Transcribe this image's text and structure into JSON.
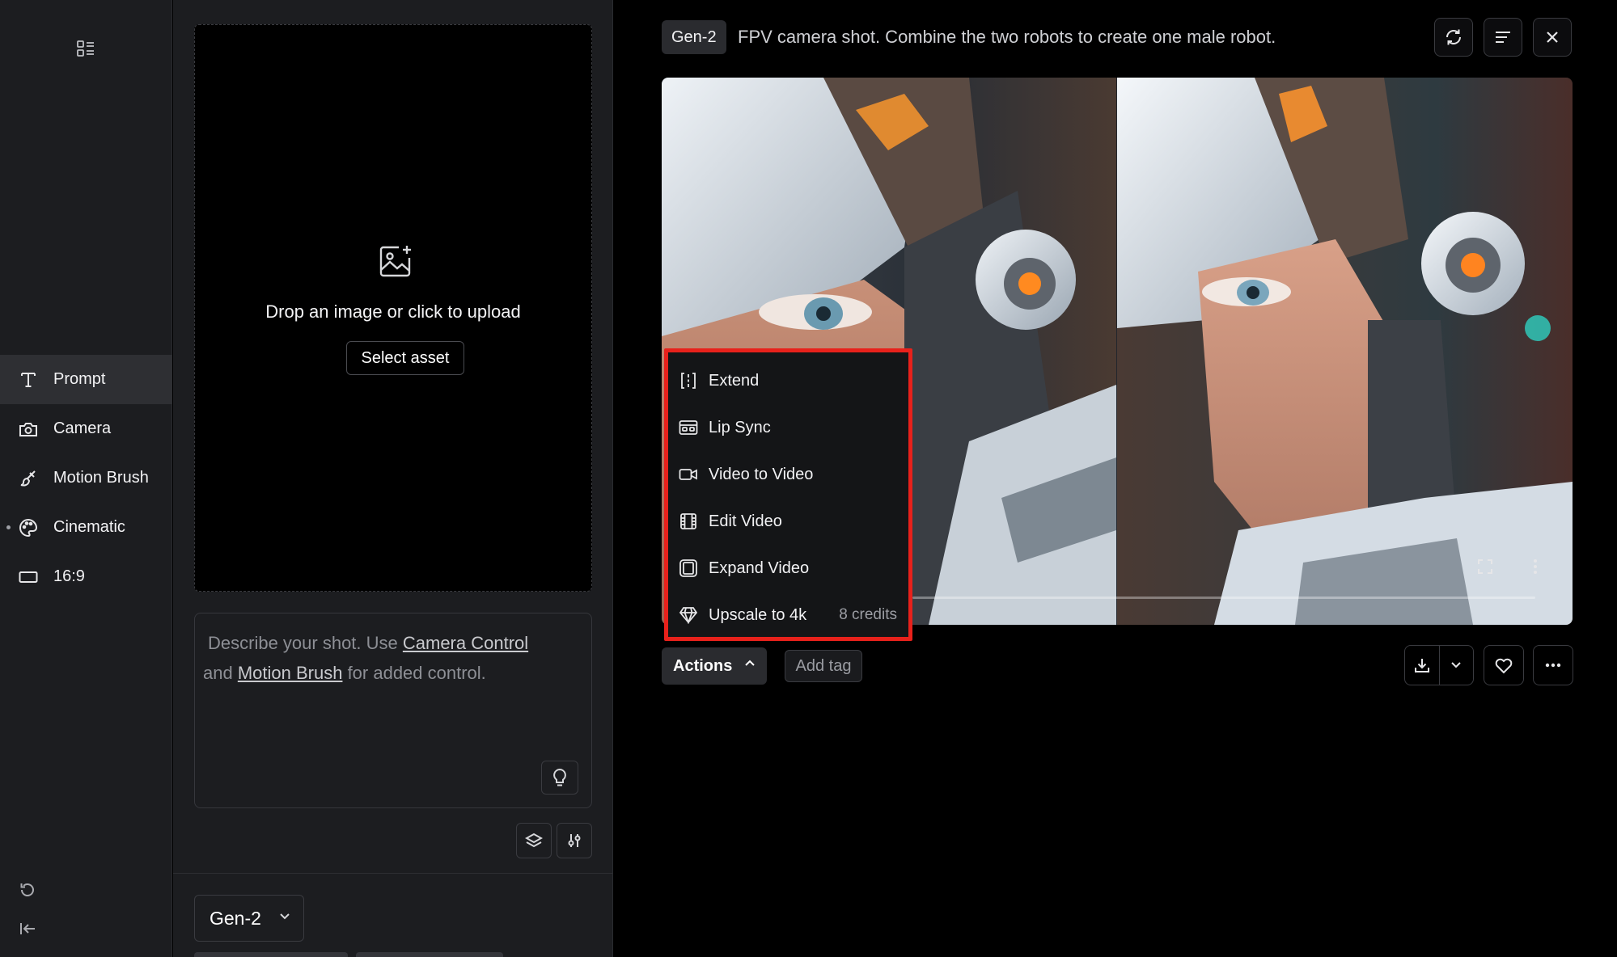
{
  "sidebar": {
    "items": [
      {
        "label": "Prompt",
        "icon": "text-t-icon",
        "active": true
      },
      {
        "label": "Camera",
        "icon": "camera-icon"
      },
      {
        "label": "Motion Brush",
        "icon": "brush-icon"
      },
      {
        "label": "Cinematic",
        "icon": "palette-icon"
      },
      {
        "label": "16:9",
        "icon": "aspect-ratio-icon"
      }
    ]
  },
  "upload": {
    "drop_text": "Drop an image or click to upload",
    "select_asset_label": "Select asset"
  },
  "prompt": {
    "part1": "Describe your shot. Use ",
    "camera_control_link": "Camera Control",
    "part2": " and ",
    "motion_brush_link": "Motion Brush",
    "part3": " for added control."
  },
  "model": {
    "selected": "Gen-2"
  },
  "output": {
    "model_badge": "Gen-2",
    "prompt_text": "FPV camera shot. Combine the two robots to create one male robot."
  },
  "actions_menu": {
    "items": [
      {
        "label": "Extend",
        "icon": "extend-icon"
      },
      {
        "label": "Lip Sync",
        "icon": "lip-sync-icon"
      },
      {
        "label": "Video to Video",
        "icon": "video-camera-icon"
      },
      {
        "label": "Edit Video",
        "icon": "film-icon"
      },
      {
        "label": "Expand Video",
        "icon": "expand-frame-icon"
      },
      {
        "label": "Upscale to 4k",
        "icon": "diamond-icon",
        "credits": "8 credits"
      }
    ]
  },
  "toolbar": {
    "actions_label": "Actions",
    "add_tag_label": "Add tag"
  },
  "colors": {
    "highlight": "#e8211b",
    "background": "#000000",
    "panel": "#1c1d20"
  }
}
